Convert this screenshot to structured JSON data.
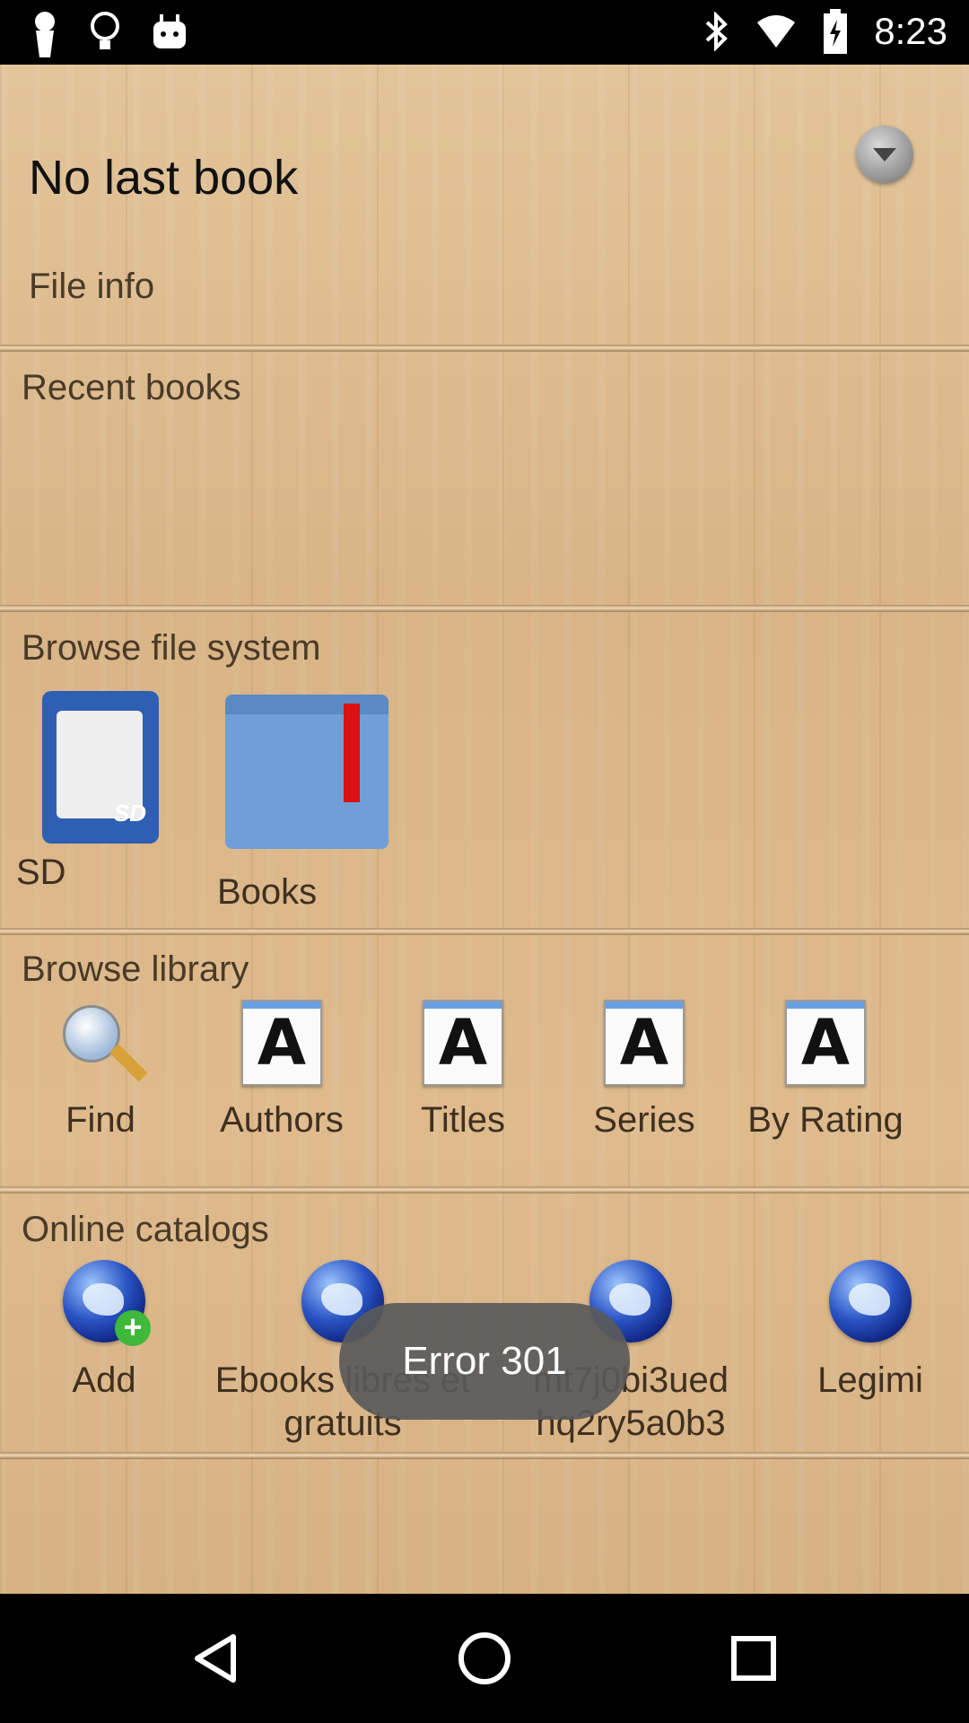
{
  "status": {
    "time": "8:23"
  },
  "last_book": {
    "title": "No last book",
    "file_info": "File info"
  },
  "sections": {
    "recent": "Recent books",
    "filesystem": "Browse file system",
    "library": "Browse library",
    "catalogs": "Online catalogs"
  },
  "filesystem": [
    {
      "label": "SD",
      "icon": "sd-card-icon"
    },
    {
      "label": "Books",
      "icon": "folder-icon"
    }
  ],
  "library": [
    {
      "label": "Find",
      "icon": "magnifier-icon"
    },
    {
      "label": "Authors",
      "icon": "letter-a-icon"
    },
    {
      "label": "Titles",
      "icon": "letter-a-icon"
    },
    {
      "label": "Series",
      "icon": "letter-a-icon"
    },
    {
      "label": "By Rating",
      "icon": "letter-a-icon"
    }
  ],
  "catalogs": [
    {
      "label": "Add",
      "icon": "globe-add-icon"
    },
    {
      "label": "Ebooks libres et gratuits",
      "icon": "globe-icon"
    },
    {
      "label": "mt7j0bi3ued hq2ry5a0b3",
      "icon": "globe-icon"
    },
    {
      "label": "Legimi",
      "icon": "globe-icon"
    }
  ],
  "toast": {
    "message": "Error 301"
  },
  "icon_letter": "A",
  "sd_label": "SD"
}
